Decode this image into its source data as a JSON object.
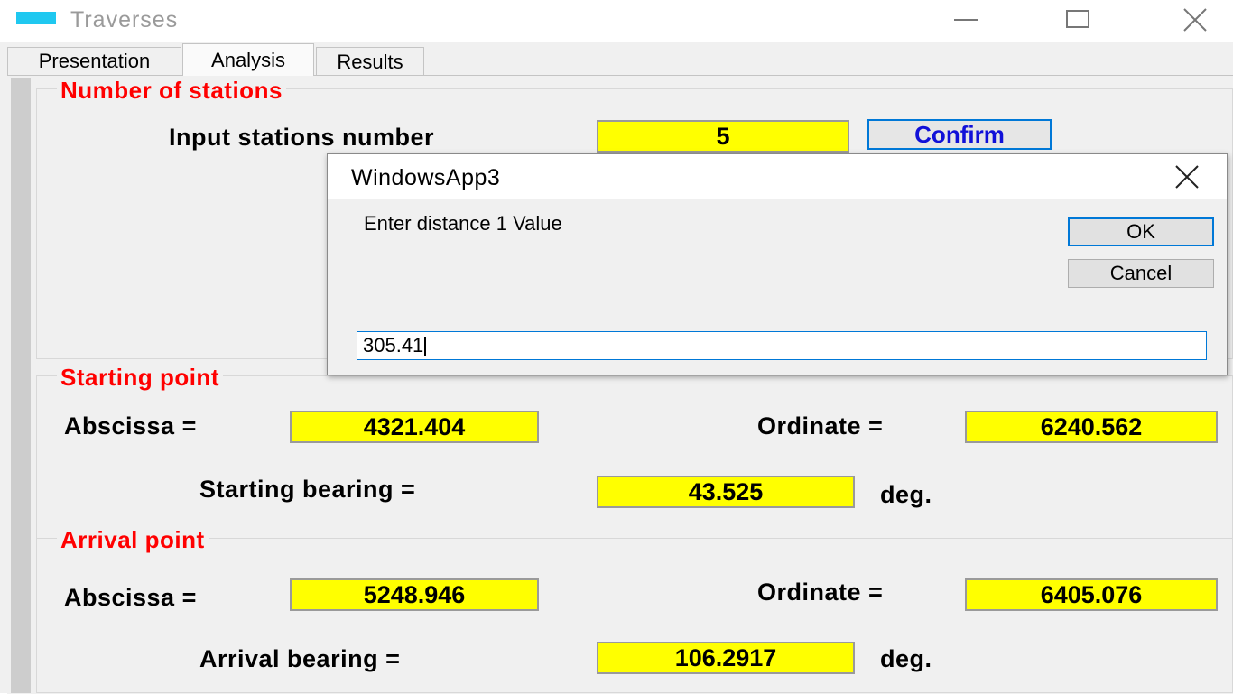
{
  "window": {
    "title": "Traverses"
  },
  "tabs": [
    {
      "label": "Presentation"
    },
    {
      "label": "Analysis"
    },
    {
      "label": "Results"
    }
  ],
  "stations": {
    "group_title": "Number of  stations",
    "input_label": "Input stations number",
    "value": "5",
    "confirm_label": "Confirm"
  },
  "starting_point": {
    "group_title": "Starting point",
    "abscissa_label": "Abscissa =",
    "abscissa_value": "4321.404",
    "ordinate_label": "Ordinate =",
    "ordinate_value": "6240.562",
    "bearing_label": "Starting bearing =",
    "bearing_value": "43.525",
    "unit": "deg."
  },
  "arrival_point": {
    "group_title": "Arrival point",
    "abscissa_label": "Abscissa =",
    "abscissa_value": "5248.946",
    "ordinate_label": "Ordinate =",
    "ordinate_value": "6405.076",
    "bearing_label": "Arrival bearing =",
    "bearing_value": "106.2917",
    "unit": "deg."
  },
  "dialog": {
    "title": "WindowsApp3",
    "prompt": "Enter distance 1  Value",
    "ok_label": "OK",
    "cancel_label": "Cancel",
    "input_value": "305.41"
  },
  "colors": {
    "accent": "#0078d7",
    "group_title": "#ff0000",
    "field_bg": "#ffff00",
    "confirm_text": "#1010d8",
    "app_icon": "#1fc8f0"
  }
}
